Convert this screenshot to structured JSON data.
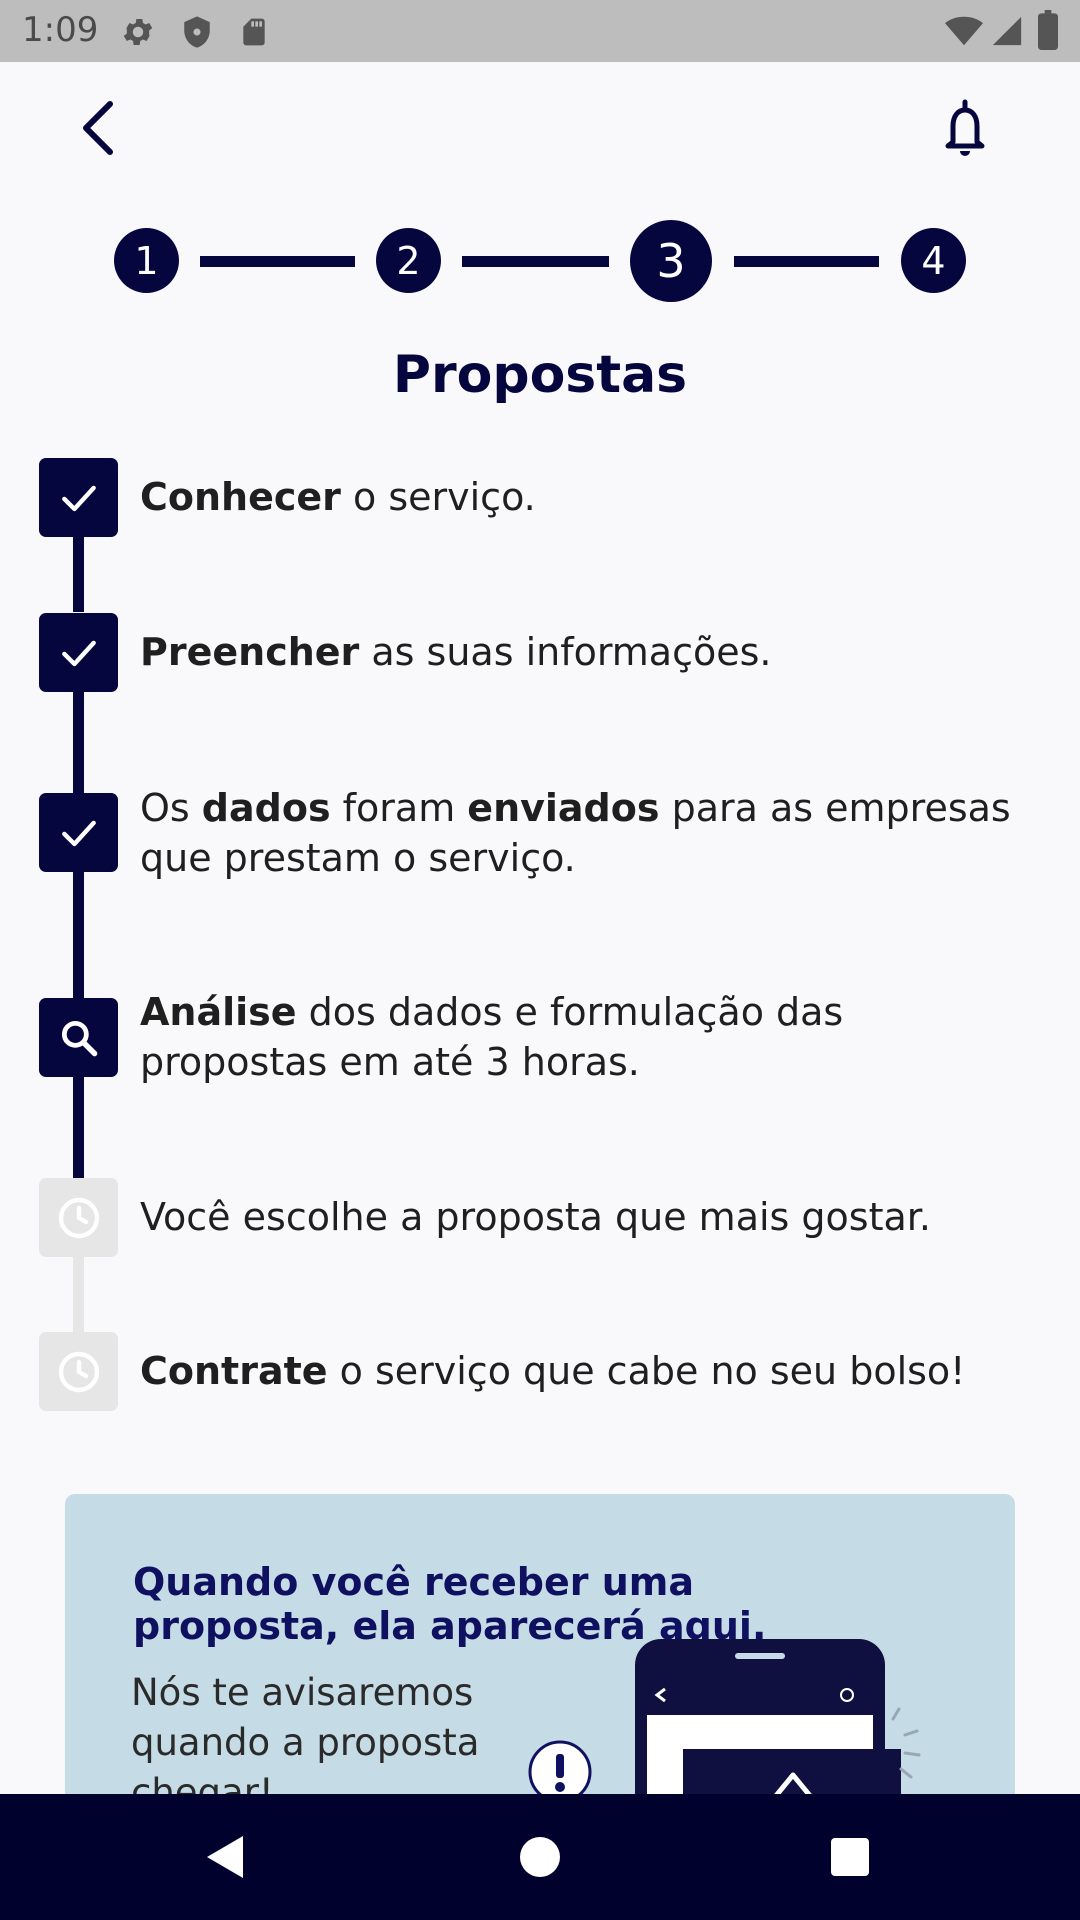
{
  "status_bar": {
    "time": "1:09",
    "left_icons": [
      "settings-icon",
      "shield-icon",
      "sd-card-icon"
    ],
    "right_icons": [
      "wifi-icon",
      "signal-icon",
      "battery-icon"
    ]
  },
  "header": {
    "back_icon": "chevron-left-icon",
    "notification_icon": "bell-icon"
  },
  "stepper": {
    "steps": [
      "1",
      "2",
      "3",
      "4"
    ],
    "current_step": 3
  },
  "title": "Propostas",
  "timeline": [
    {
      "status": "done",
      "icon": "check-icon",
      "parts": [
        {
          "b": "Conhecer"
        },
        {
          "t": " o serviço."
        }
      ]
    },
    {
      "status": "done",
      "icon": "check-icon",
      "parts": [
        {
          "b": "Preencher"
        },
        {
          "t": " as suas informações."
        }
      ]
    },
    {
      "status": "done",
      "icon": "check-icon",
      "parts": [
        {
          "t": "Os "
        },
        {
          "b": "dados"
        },
        {
          "t": " foram "
        },
        {
          "b": "enviados"
        },
        {
          "t": " para as empresas"
        },
        {
          "br": true
        },
        {
          "t": "que prestam o serviço."
        }
      ]
    },
    {
      "status": "current",
      "icon": "search-icon",
      "parts": [
        {
          "b": "Análise"
        },
        {
          "t": " dos dados e formulação das"
        },
        {
          "br": true
        },
        {
          "t": "propostas em até 3 horas."
        }
      ]
    },
    {
      "status": "pending",
      "icon": "clock-icon",
      "parts": [
        {
          "t": "Você escolhe a proposta que mais gostar."
        }
      ]
    },
    {
      "status": "pending",
      "icon": "clock-icon",
      "parts": [
        {
          "b": "Contrate"
        },
        {
          "t": " o serviço que cabe no seu bolso!"
        }
      ]
    }
  ],
  "info_card": {
    "heading": "Quando você receber uma proposta, ela aparecerá aqui.",
    "text": "Nós te avisaremos quando a proposta chegar!"
  },
  "colors": {
    "primary": "#06063f",
    "pending": "#e6e6e6",
    "card_bg": "#c5dbe6",
    "nav_bg": "#01012e"
  },
  "nav_bar": {
    "back_icon": "nav-back-triangle-icon",
    "home_icon": "nav-home-circle-icon",
    "recents_icon": "nav-recents-square-icon"
  }
}
